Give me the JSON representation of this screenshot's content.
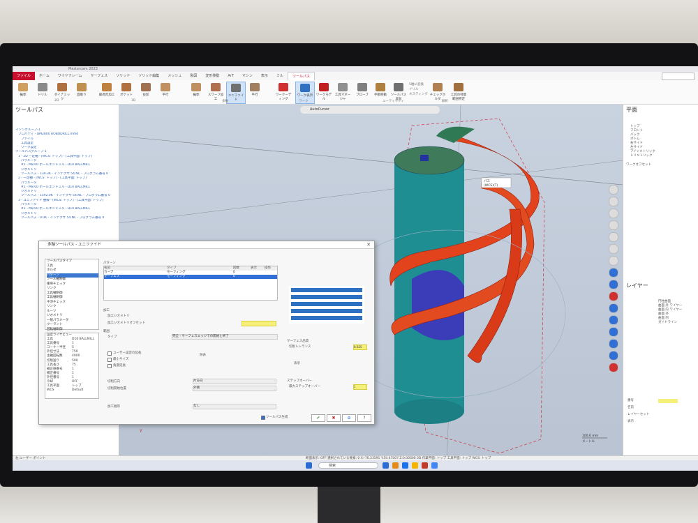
{
  "window": {
    "title": "Mastercam 2023",
    "search_label": "検索"
  },
  "ribbon": {
    "tabs": [
      "ファイル",
      "ホーム",
      "ワイヤフレーム",
      "サーフェス",
      "ソリッド",
      "ソリッド編集",
      "メッシュ",
      "製図",
      "変形移動",
      "ArT",
      "マシン",
      "表示",
      "ミル",
      "ツールパス"
    ],
    "buttons": [
      {
        "label": "輪郭",
        "color": "#d0a060"
      },
      {
        "label": "ドリル",
        "color": "#8a8a8a"
      },
      {
        "label": "ダイナミック",
        "color": "#b07040"
      },
      {
        "label": "面削り",
        "color": "#c09050"
      },
      {
        "label": "最適荒加工",
        "color": "#c08040"
      },
      {
        "label": "ポケット",
        "color": "#b07040"
      },
      {
        "label": "投影",
        "color": "#a07050"
      },
      {
        "label": "平行",
        "color": "#c09060"
      },
      {
        "label": "輪郭",
        "color": "#c09060"
      },
      {
        "label": "スワーフ加工",
        "color": "#b07050"
      },
      {
        "label": "ユニファイド",
        "color": "#707070"
      },
      {
        "label": "平行",
        "color": "#a08060"
      },
      {
        "label": "ワークーディング",
        "color": "#d03030"
      },
      {
        "label": "ワーク表示",
        "color": "#3070c0"
      },
      {
        "label": "ワークモデル",
        "color": "#c02020"
      },
      {
        "label": "工具マネージャ",
        "color": "#909090"
      },
      {
        "label": "プローブ",
        "color": "#808080"
      },
      {
        "label": "手動移動",
        "color": "#b08040"
      },
      {
        "label": "ツールパス変形",
        "color": "#707070"
      },
      {
        "label": "チェックホルダ",
        "color": "#b08050"
      },
      {
        "label": "工具の残量範囲特定",
        "color": "#a07040"
      }
    ],
    "groups": [
      "2D",
      "3D",
      "多軸",
      "ワーク",
      "ユーティリティ",
      "解析"
    ],
    "small_items": [
      "5軸に変換",
      "ドリル",
      "ネスティング"
    ]
  },
  "left_panel": {
    "title": "ツールパス",
    "tree": [
      "マシングループ-1",
      "プロパティ - DM2800 ROBODRILL.mmd",
      "ファイル",
      "工具設定",
      "ワーク設定",
      "ツールパスグループ-1",
      "1 - 2D 一定軸 - [WCS: トップ] - [工具平面: トップ]",
      "パラメータ",
      "#1 - M8.00 ボールエンドミル - D10 BALLMILL",
      "ジオメトリ",
      "ツールパス - 139.3K - インデクサ 54.NC - プログラム番号 0",
      "2 - 一定軸 - [WCS: トップ] - [工具平面: トップ]",
      "パラメータ",
      "#1 - M8.00 ボールエンドミル - D10 BALLMILL",
      "ジオメトリ",
      "ツールパス - 1592.0K - インデクサ 54.NC - プログラム番号 0",
      "3 - ユニファイド 曲線 - [WCS: トップ] - [工具平面: トップ]",
      "パラメータ",
      "#1 - M8.00 ボールエンドミル - D10 BALLMILL",
      "ジオメトリ",
      "ツールパス - 0.0K - インデクサ 54.NC - プログラム番号 0"
    ]
  },
  "viewport": {
    "autocursor": "AutoCursor",
    "tooltip": [
      "パス",
      "(WCS)(T)"
    ],
    "scale": "100.6 mm",
    "scale_unit": "メートル"
  },
  "right_panel": {
    "title": "平面",
    "plane_list": [
      "トップ",
      "フロント",
      "バック",
      "ボトム",
      "右サイド",
      "左サイド",
      "アイソメトリック",
      "トリメトリック"
    ],
    "plane_label": "ワークオフセット",
    "layers_title": "レイヤー",
    "layer_list": [
      "円柱曲面",
      "曲面 外 ワイヤー",
      "曲面 内 ワイヤー",
      "曲面 外",
      "曲面 内",
      "ガイドライン"
    ],
    "bottom_labels": [
      "番号",
      "名前",
      "レイヤーセット",
      "表示"
    ]
  },
  "dialog": {
    "title": "多軸ツールパス - ユニファイド",
    "tree": [
      "ツールパスタイプ",
      "工具",
      "ホルダ",
      "パターン",
      "ツール軸制御",
      "衝突チェック",
      "リンク",
      "工具軸制御",
      "工具軸制御",
      "干渉チェック",
      "リンク",
      "ルーツ",
      "ジオメトリ",
      "一般パラメータ",
      "クーラント",
      "回転軸制御"
    ],
    "tree_selected": "パターン",
    "props_title": "設定ライヤビュー",
    "props": [
      "工具",
      "工具番号",
      "コーナー半径",
      "外径寸法",
      "主軸回転数",
      "切削送り",
      "工具長さ",
      "補正値番号",
      "補正番号",
      "外径番号",
      "冷却",
      "工具平面",
      "WCS"
    ],
    "props_values": [
      "D10 BALLMILL",
      "1",
      "5",
      "750",
      "4000",
      "500",
      "75",
      "1",
      "1",
      "1",
      "OFF",
      "トップ",
      "Default"
    ],
    "pattern_label": "パターン",
    "pattern_headers": [
      "名前",
      "タイプ",
      "回数",
      "表示",
      "操作"
    ],
    "pattern_rows": [
      {
        "name": "カーブ",
        "type": "モーフィング",
        "count": "0"
      },
      {
        "name": "サーフェス",
        "type": "モーフィング",
        "count": "0"
      }
    ],
    "stock_label": "加工",
    "stock_label2": "加工ジオメトリ",
    "stock_label3": "加工ジオメトリオフセット",
    "range_label": "範囲",
    "type_label": "タイプ",
    "type_value": "完全 - サーフェスエッジでの開始と終了",
    "surface_quality": "サーフェス品質",
    "cut_tol": "切削トレランス",
    "cut_tol_value": "0.025",
    "checkboxes": [
      "ユーザー設定の延長",
      "最小サイズ",
      "角度延長"
    ],
    "feature_label": "除去",
    "feature_label2": "表示",
    "step_label": "ステップオーバー",
    "step_max": "最大ステップオーバー",
    "step_value": "1",
    "cut_order_label": "切削方向",
    "cut_order_value": "片方向",
    "cut_start": "切削開始位置",
    "cut_start_value": "外側",
    "sort_label": "加工順序",
    "sort_value": "なし",
    "footer_check": "ツールパス生成",
    "buttons": [
      "✔",
      "✖",
      "⊕",
      "?"
    ]
  },
  "statusbar": {
    "text": "断面表示: OFF   選択されている要素: 0   X:-76.23591   Y:50.47007   Z:0.00000   3D   作業平面: トップ   工具平面: トップ   WCS: トップ",
    "left": "左:ユーザー  ポイント"
  },
  "taskbar": {
    "search_placeholder": "検索",
    "icons": [
      "#2b6cd4",
      "#e28a1a",
      "#1a73e8",
      "#f4b400",
      "#c0392b",
      "#4285f4"
    ]
  }
}
